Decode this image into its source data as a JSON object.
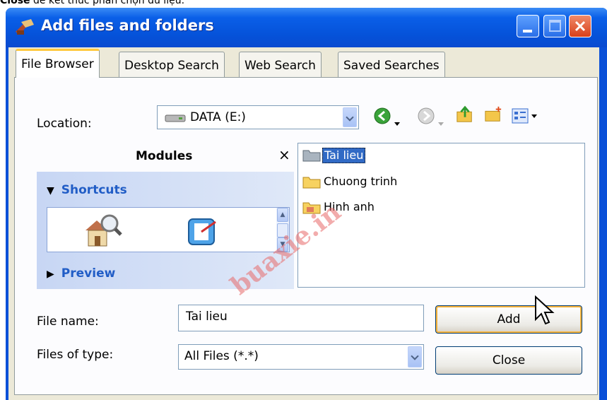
{
  "caption": {
    "bold": "Close",
    "rest": " để kết thúc phần chọn dữ liệu."
  },
  "window": {
    "title": "Add files and folders",
    "icon": "add-files-icon"
  },
  "tabs": [
    {
      "label": "File Browser",
      "active": true
    },
    {
      "label": "Desktop Search"
    },
    {
      "label": "Web Search"
    },
    {
      "label": "Saved Searches"
    }
  ],
  "location": {
    "label": "Location:",
    "value": "DATA (E:)",
    "icon": "drive-icon"
  },
  "toolbar": {
    "icons": [
      "back-icon",
      "dropdown-arrow-icon",
      "forward-icon",
      "dropdown-arrow-icon",
      "up-folder-icon",
      "new-folder-icon",
      "view-menu-icon"
    ]
  },
  "modules": {
    "title": "Modules",
    "close": "×",
    "shortcuts_label": "Shortcuts",
    "preview_label": "Preview",
    "shortcut_icons": [
      "home-search-icon",
      "shortcut-app-icon"
    ]
  },
  "files": [
    {
      "name": "Tai lieu",
      "selected": true,
      "icon": "folder-grey-icon"
    },
    {
      "name": "Chuong trinh",
      "icon": "folder-icon"
    },
    {
      "name": "Hinh anh",
      "icon": "folder-icon"
    }
  ],
  "filename": {
    "label": "File name:",
    "value": "Tai lieu"
  },
  "filetype": {
    "label": "Files of type:",
    "value": "All Files (*.*)"
  },
  "buttons": {
    "add": "Add",
    "close": "Close"
  },
  "watermark": "buaxie.in",
  "colors": {
    "title_bar": "#0a5fe8",
    "selection": "#316ac5",
    "link": "#215dc6"
  }
}
